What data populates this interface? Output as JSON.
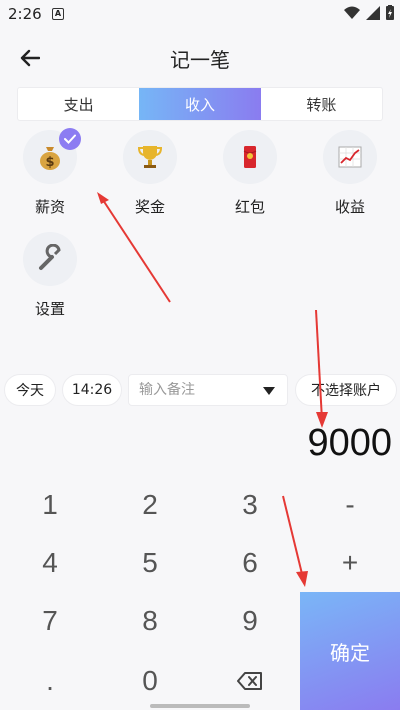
{
  "status": {
    "time": "2:26",
    "notification_letter": "A"
  },
  "header": {
    "title": "记一笔"
  },
  "tabs": [
    {
      "label": "支出",
      "active": false
    },
    {
      "label": "收入",
      "active": true
    },
    {
      "label": "转账",
      "active": false
    }
  ],
  "categories": [
    {
      "label": "薪资",
      "icon": "money-bag-icon",
      "selected": true
    },
    {
      "label": "奖金",
      "icon": "trophy-icon",
      "selected": false
    },
    {
      "label": "红包",
      "icon": "red-envelope-icon",
      "selected": false
    },
    {
      "label": "收益",
      "icon": "chart-icon",
      "selected": false
    },
    {
      "label": "设置",
      "icon": "wrench-icon",
      "selected": false
    }
  ],
  "info": {
    "date": "今天",
    "time": "14:26",
    "note_placeholder": "输入备注",
    "account": "不选择账户"
  },
  "amount": "9000",
  "keypad": {
    "keys": [
      "1",
      "2",
      "3",
      "-",
      "4",
      "5",
      "6",
      "+",
      "7",
      "8",
      "9",
      "."
    ],
    "zero": "0",
    "confirm": "确定"
  },
  "colors": {
    "accent_start": "#76b6f6",
    "accent_end": "#8a7cf0",
    "annotation_arrow": "#e53935"
  }
}
